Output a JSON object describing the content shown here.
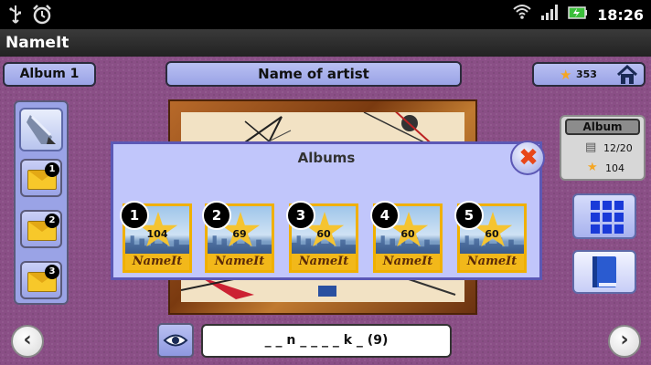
{
  "status_bar": {
    "time": "18:26",
    "left_icons": [
      "usb-icon",
      "alarm-clock-icon"
    ],
    "right_icons": [
      "wifi-icon",
      "signal-icon",
      "battery-charging-icon"
    ]
  },
  "app": {
    "title": "NameIt"
  },
  "top_bar": {
    "album_label": "Album 1",
    "artist_label": "Name of artist",
    "score": "353"
  },
  "left_panel": {
    "envelopes": [
      "1",
      "2",
      "3"
    ]
  },
  "right_panel": {
    "album_tag": "Album",
    "progress": "12/20",
    "points": "104"
  },
  "bottom_bar": {
    "answer_hint": "_ _ n _ _ _ _ k _    (9)"
  },
  "dialog": {
    "title": "Albums",
    "albums": [
      {
        "number": "1",
        "score": "104",
        "brand": "NameIt"
      },
      {
        "number": "2",
        "score": "69",
        "brand": "NameIt"
      },
      {
        "number": "3",
        "score": "60",
        "brand": "NameIt"
      },
      {
        "number": "4",
        "score": "60",
        "brand": "NameIt"
      },
      {
        "number": "5",
        "score": "60",
        "brand": "NameIt"
      }
    ]
  },
  "colors": {
    "background": "#8a4f86",
    "panel_blue": "#9aa3e6",
    "dialog_bg": "#c1c6fb",
    "accent_gold": "#f0b000",
    "close_red": "#e8471a"
  }
}
